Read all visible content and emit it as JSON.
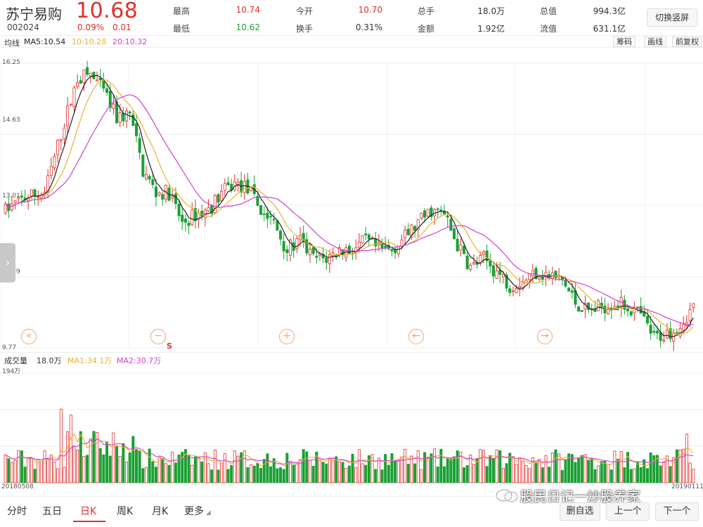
{
  "header": {
    "stock_name": "苏宁易购",
    "price": "10.68",
    "code": "002024",
    "change_pct": "0.09%",
    "change": "0.01",
    "stats": [
      {
        "label": "最高",
        "value": "10.74",
        "color": "#e0302d"
      },
      {
        "label": "今开",
        "value": "10.70",
        "color": "#e0302d"
      },
      {
        "label": "总手",
        "value": "18.0万",
        "color": "#333333"
      },
      {
        "label": "总值",
        "value": "994.3亿",
        "color": "#333333"
      },
      {
        "label": "最低",
        "value": "10.62",
        "color": "#1aa033"
      },
      {
        "label": "换手",
        "value": "0.31%",
        "color": "#333333"
      },
      {
        "label": "金额",
        "value": "1.92亿",
        "color": "#333333"
      },
      {
        "label": "流值",
        "value": "631.1亿",
        "color": "#333333"
      }
    ],
    "switch_label": "切换竖屏"
  },
  "ma_legend": {
    "label": "均线",
    "ma5": "MA5:10.54",
    "ma10": "10:10.28",
    "ma20": "20:10.32",
    "tools": [
      "筹码",
      "画线",
      "前复权"
    ]
  },
  "y_axis": [
    "16.25",
    "14.63",
    "13.01",
    "11.39",
    "9.77"
  ],
  "controls": [
    "«",
    "−",
    "+",
    "←",
    "→"
  ],
  "s_marker": "S",
  "volume": {
    "label": "成交量",
    "value": "18.0万",
    "ma1": "MA1:34.1万",
    "ma2": "MA2:30.7万",
    "max": "194万"
  },
  "dates": {
    "start": "20180508",
    "end": "20190111"
  },
  "tabs": [
    "分时",
    "五日",
    "日K",
    "周K",
    "月K",
    "更多"
  ],
  "active_tab": "日K",
  "buttons": [
    "删自选",
    "上一个",
    "下一个"
  ],
  "watermark": "股民日记一炒股养家",
  "colors": {
    "up": "#e0302d",
    "down": "#1aa033",
    "ma5": "#222222",
    "ma10": "#f0b030",
    "ma20": "#d040d0",
    "accent": "#e8a57c"
  },
  "chart_data": {
    "type": "candlestick",
    "ylim": [
      9.77,
      16.25
    ],
    "trend_anchors": [
      [
        0,
        12.9
      ],
      [
        6,
        13.2
      ],
      [
        12,
        13.3
      ],
      [
        18,
        14.9
      ],
      [
        22,
        15.9
      ],
      [
        26,
        16.0
      ],
      [
        30,
        15.6
      ],
      [
        34,
        15.0
      ],
      [
        38,
        15.1
      ],
      [
        42,
        13.8
      ],
      [
        46,
        13.3
      ],
      [
        50,
        13.3
      ],
      [
        54,
        12.6
      ],
      [
        58,
        12.8
      ],
      [
        62,
        12.9
      ],
      [
        66,
        13.3
      ],
      [
        70,
        13.5
      ],
      [
        74,
        13.4
      ],
      [
        78,
        12.9
      ],
      [
        82,
        12.6
      ],
      [
        86,
        12.0
      ],
      [
        90,
        12.2
      ],
      [
        94,
        11.8
      ],
      [
        98,
        11.8
      ],
      [
        102,
        12.0
      ],
      [
        106,
        12.0
      ],
      [
        110,
        12.2
      ],
      [
        114,
        12.0
      ],
      [
        118,
        12.0
      ],
      [
        122,
        12.3
      ],
      [
        126,
        12.6
      ],
      [
        130,
        12.9
      ],
      [
        134,
        12.8
      ],
      [
        138,
        12.1
      ],
      [
        142,
        11.6
      ],
      [
        146,
        11.8
      ],
      [
        150,
        11.5
      ],
      [
        154,
        11.2
      ],
      [
        158,
        11.3
      ],
      [
        162,
        11.5
      ],
      [
        166,
        11.4
      ],
      [
        170,
        11.3
      ],
      [
        174,
        10.8
      ],
      [
        178,
        10.6
      ],
      [
        182,
        10.7
      ],
      [
        186,
        10.8
      ],
      [
        190,
        10.7
      ],
      [
        194,
        10.5
      ],
      [
        198,
        10.0
      ],
      [
        202,
        10.1
      ],
      [
        206,
        10.3
      ],
      [
        210,
        10.7
      ]
    ],
    "volume_max_wan": 194
  }
}
